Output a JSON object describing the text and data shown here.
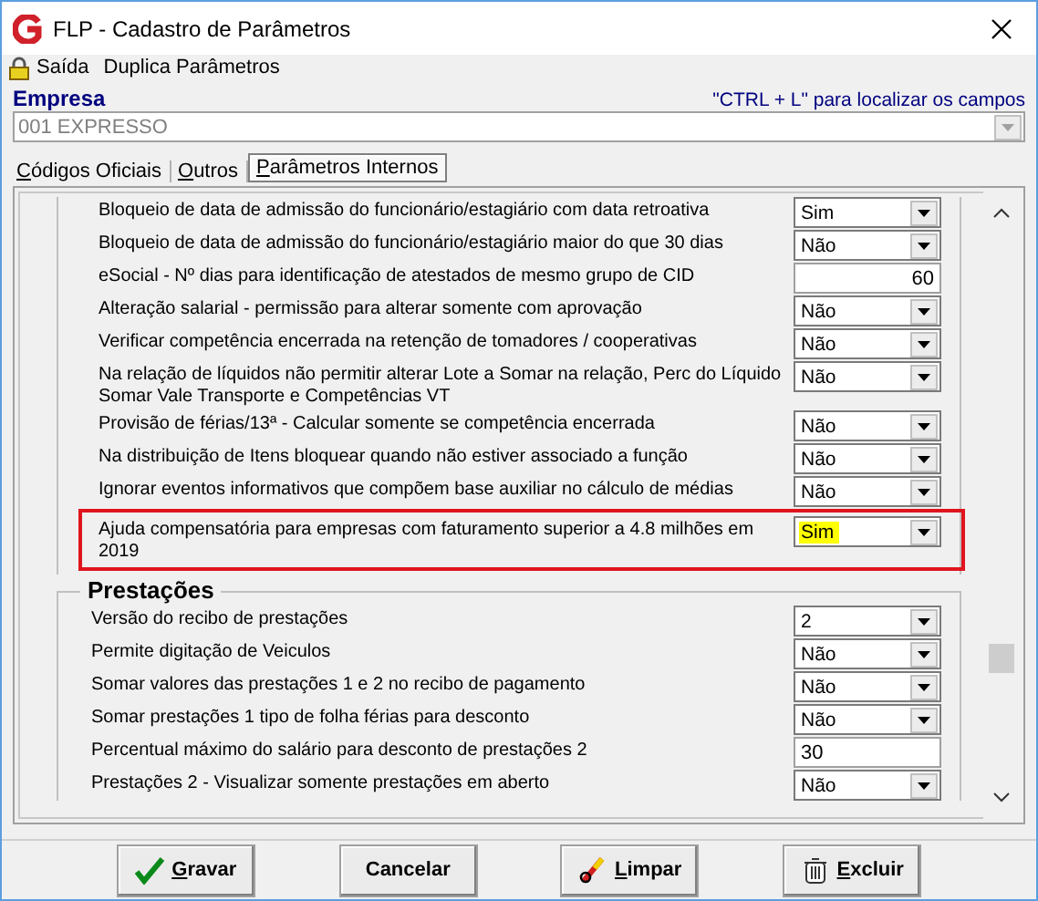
{
  "window": {
    "title": "FLP - Cadastro de Parâmetros"
  },
  "menu": [
    {
      "label": "Saída",
      "kind": "lock"
    },
    {
      "label": "Duplica Parâmetros",
      "kind": "plain"
    }
  ],
  "empresa": {
    "label": "Empresa",
    "hint": "\"CTRL + L\" para localizar os campos",
    "value": "001 EXPRESSO"
  },
  "tabs": [
    {
      "label": "Códigos Oficiais",
      "selected": false
    },
    {
      "label": "Outros",
      "selected": false
    },
    {
      "label": "Parâmetros Internos",
      "selected": true
    }
  ],
  "parameters": [
    {
      "label": "Bloqueio de data de admissão do funcionário/estagiário com data retroativa",
      "kind": "select",
      "value": "Sim",
      "highlighted": false
    },
    {
      "label": "Bloqueio de data de admissão do funcionário/estagiário maior do que 30 dias",
      "kind": "select",
      "value": "Não",
      "highlighted": false
    },
    {
      "label": "eSocial - Nº dias para identificação de atestados de mesmo grupo de CID",
      "kind": "number",
      "value": "60",
      "highlighted": false
    },
    {
      "label": "Alteração salarial - permissão para alterar somente com aprovação",
      "kind": "select",
      "value": "Não",
      "highlighted": false
    },
    {
      "label": "Verificar competência encerrada na retenção de tomadores / cooperativas",
      "kind": "select",
      "value": "Não",
      "highlighted": false
    },
    {
      "label": "Na relação de líquidos não permitir alterar Lote a Somar na relação, Perc do Líquido Somar Vale Transporte e  Competências VT",
      "kind": "select",
      "value": "Não",
      "highlighted": false
    },
    {
      "label": "Provisão de férias/13ª - Calcular somente se competência encerrada",
      "kind": "select",
      "value": "Não",
      "highlighted": false
    },
    {
      "label": "Na distribuição de Itens bloquear quando não estiver associado a função",
      "kind": "select",
      "value": "Não",
      "highlighted": false
    },
    {
      "label": "Ignorar eventos informativos que compõem base auxiliar no cálculo de médias",
      "kind": "select",
      "value": "Não",
      "highlighted": false
    },
    {
      "label": "Ajuda compensatória para empresas com faturamento superior a 4.8 milhões em 2019",
      "kind": "select",
      "value": "Sim",
      "highlighted": true
    }
  ],
  "prestacoes": {
    "title": "Prestações",
    "rows": [
      {
        "label": "Versão do recibo de prestações",
        "kind": "select",
        "value": "2"
      },
      {
        "label": "Permite digitação de Veiculos",
        "kind": "select",
        "value": "Não"
      },
      {
        "label": "Somar valores das prestações 1 e 2 no recibo de pagamento",
        "kind": "select",
        "value": "Não"
      },
      {
        "label": "Somar prestações 1 tipo de folha férias para desconto",
        "kind": "select",
        "value": "Não"
      },
      {
        "label": "Percentual máximo do salário para desconto de prestações 2",
        "kind": "text",
        "value": "30"
      },
      {
        "label": "Prestações 2 - Visualizar somente prestações em aberto",
        "kind": "select",
        "value": "Não"
      }
    ]
  },
  "buttons": [
    {
      "label": "Gravar",
      "kind": "save"
    },
    {
      "label": "Cancelar",
      "kind": "cancel"
    },
    {
      "label": "Limpar",
      "kind": "clear"
    },
    {
      "label": "Excluir",
      "kind": "delete"
    }
  ]
}
